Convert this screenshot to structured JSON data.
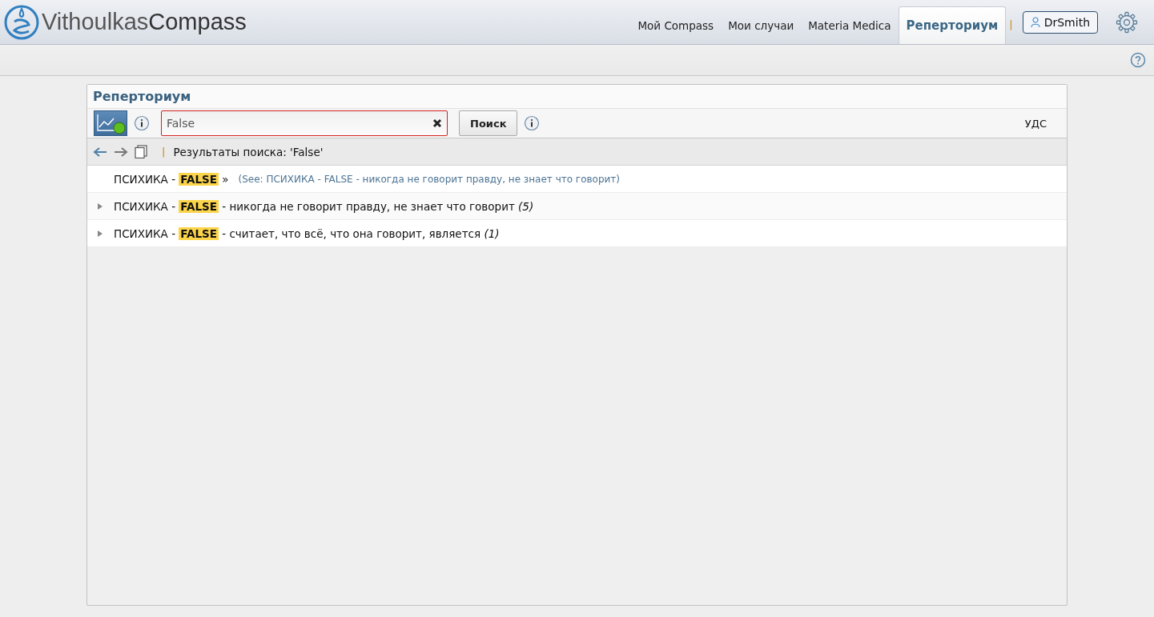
{
  "logo": {
    "light": "Vithoulkas",
    "bold": "Compass"
  },
  "nav_tabs": [
    {
      "label": "Мой Compass",
      "selected": false
    },
    {
      "label": "Мои случаи",
      "selected": false
    },
    {
      "label": "Materia Medica",
      "selected": false
    },
    {
      "label": "Реперториум",
      "selected": true
    }
  ],
  "separator": "|",
  "user_button": "DrSmith",
  "panel": {
    "title": "Реперториум",
    "search": {
      "value": "False"
    },
    "search_button": "Поиск",
    "right_label": "УДС",
    "breadcrumb_separator": "|",
    "results_heading": "Результаты поиска: 'False'",
    "rows": [
      {
        "kind": "see",
        "prefix": "ПСИХИКА - ",
        "match": "FALSE",
        "rest": " »",
        "count": "",
        "see": "(See: ПСИХИКА - FALSE - никогда не говорит правду, не знает что говорит)"
      },
      {
        "kind": "rubric",
        "prefix": "ПСИХИКА - ",
        "match": "FALSE",
        "rest": " - никогда не говорит правду, не знает что говорит ",
        "count": "(5)",
        "see": ""
      },
      {
        "kind": "rubric",
        "prefix": "ПСИХИКА - ",
        "match": "FALSE",
        "rest": " - считает, что всё, что она говорит, является ",
        "count": "(1)",
        "see": ""
      }
    ]
  }
}
